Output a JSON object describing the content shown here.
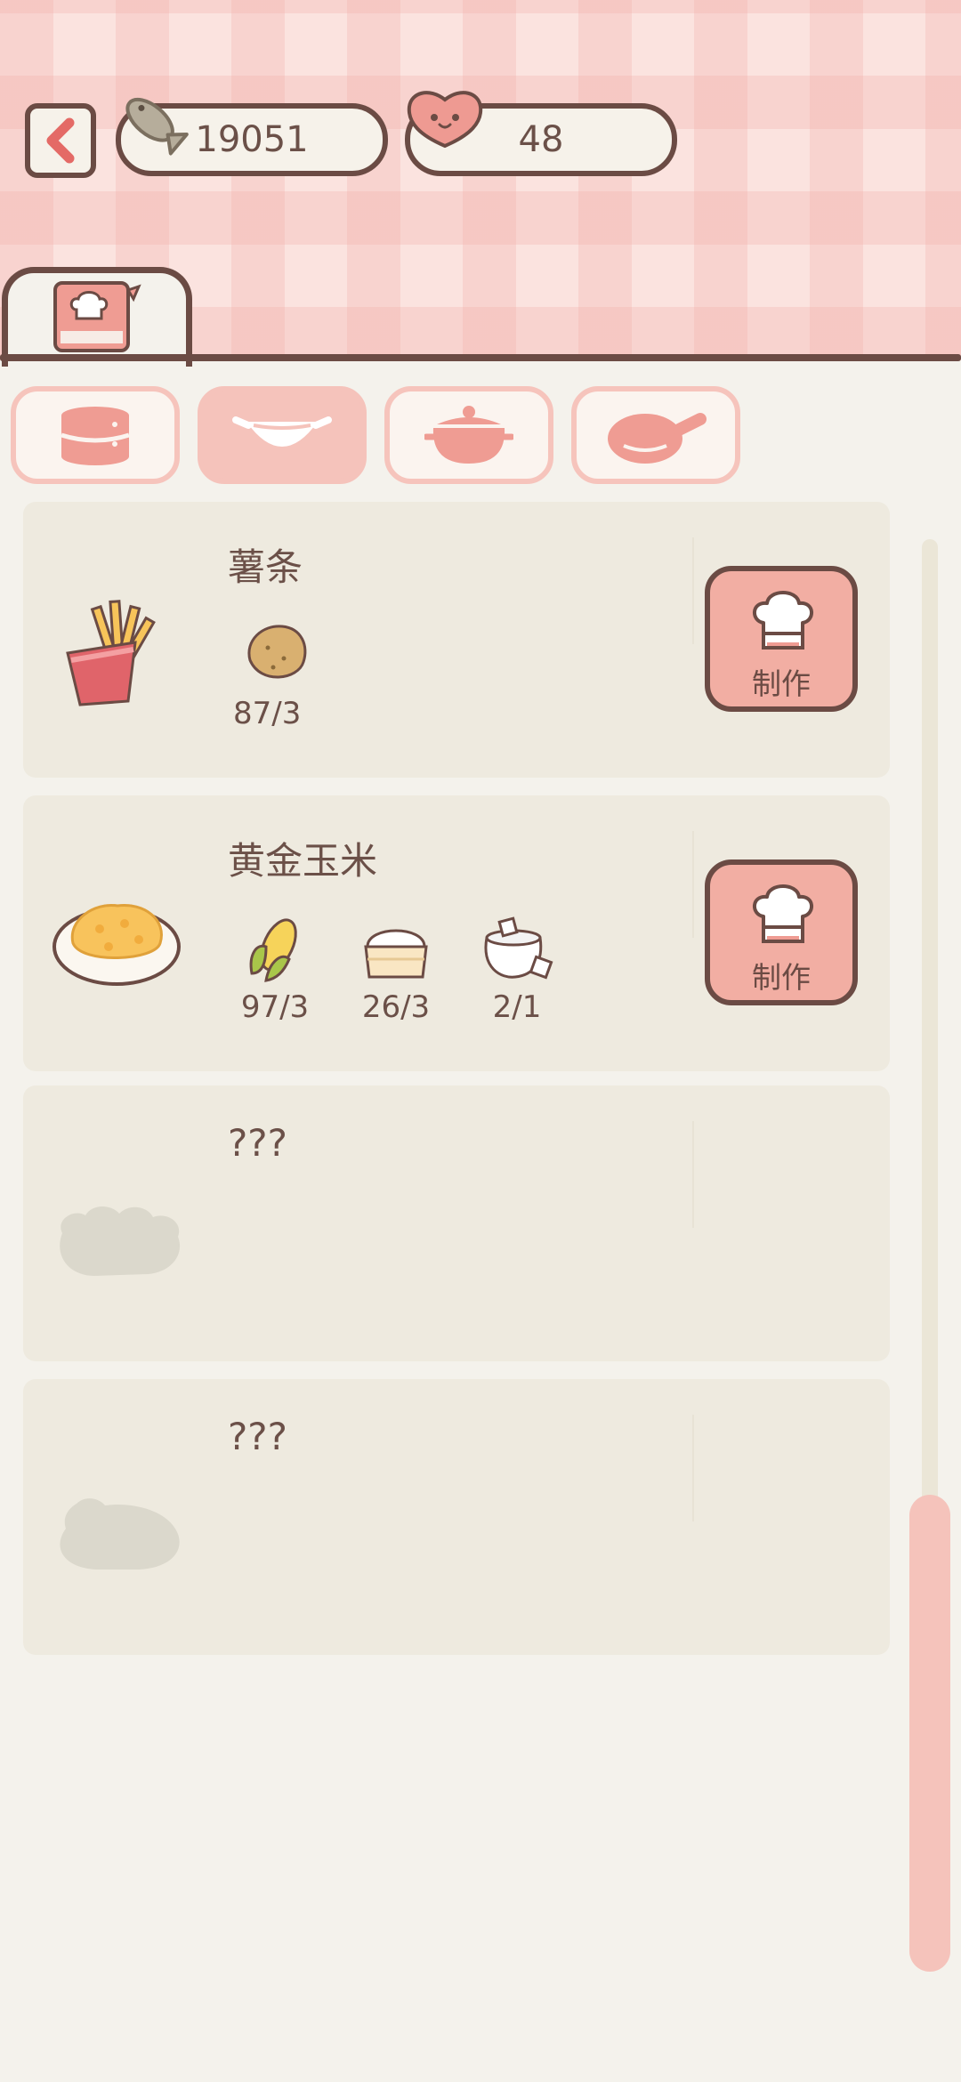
{
  "currency": {
    "fish": {
      "value": "19051",
      "icon": "fish-icon"
    },
    "heart": {
      "value": "48",
      "icon": "heart-icon"
    }
  },
  "tabs": {
    "main": {
      "icon": "recipe-book-icon"
    },
    "categories": [
      {
        "icon": "steamer-icon",
        "active": false
      },
      {
        "icon": "wok-icon",
        "active": true
      },
      {
        "icon": "pot-icon",
        "active": false
      },
      {
        "icon": "pan-icon",
        "active": false
      }
    ]
  },
  "recipes": [
    {
      "title": "薯条",
      "icon": "fries-icon",
      "ingredients": [
        {
          "icon": "potato-icon",
          "count": "87/3"
        }
      ],
      "button_label": "制作"
    },
    {
      "title": "黄金玉米",
      "icon": "golden-corn-dish-icon",
      "ingredients": [
        {
          "icon": "corn-icon",
          "count": "97/3"
        },
        {
          "icon": "flour-icon",
          "count": "26/3"
        },
        {
          "icon": "sugar-icon",
          "count": "2/1"
        }
      ],
      "button_label": "制作"
    },
    {
      "title": "???",
      "icon": "locked-dish-icon",
      "ingredients": []
    },
    {
      "title": "???",
      "icon": "locked-dish-icon",
      "ingredients": []
    }
  ],
  "colors": {
    "accent": "#f2aea3",
    "outline": "#6b4b44",
    "card": "#eeeadf",
    "background": "#f4f2ec"
  }
}
